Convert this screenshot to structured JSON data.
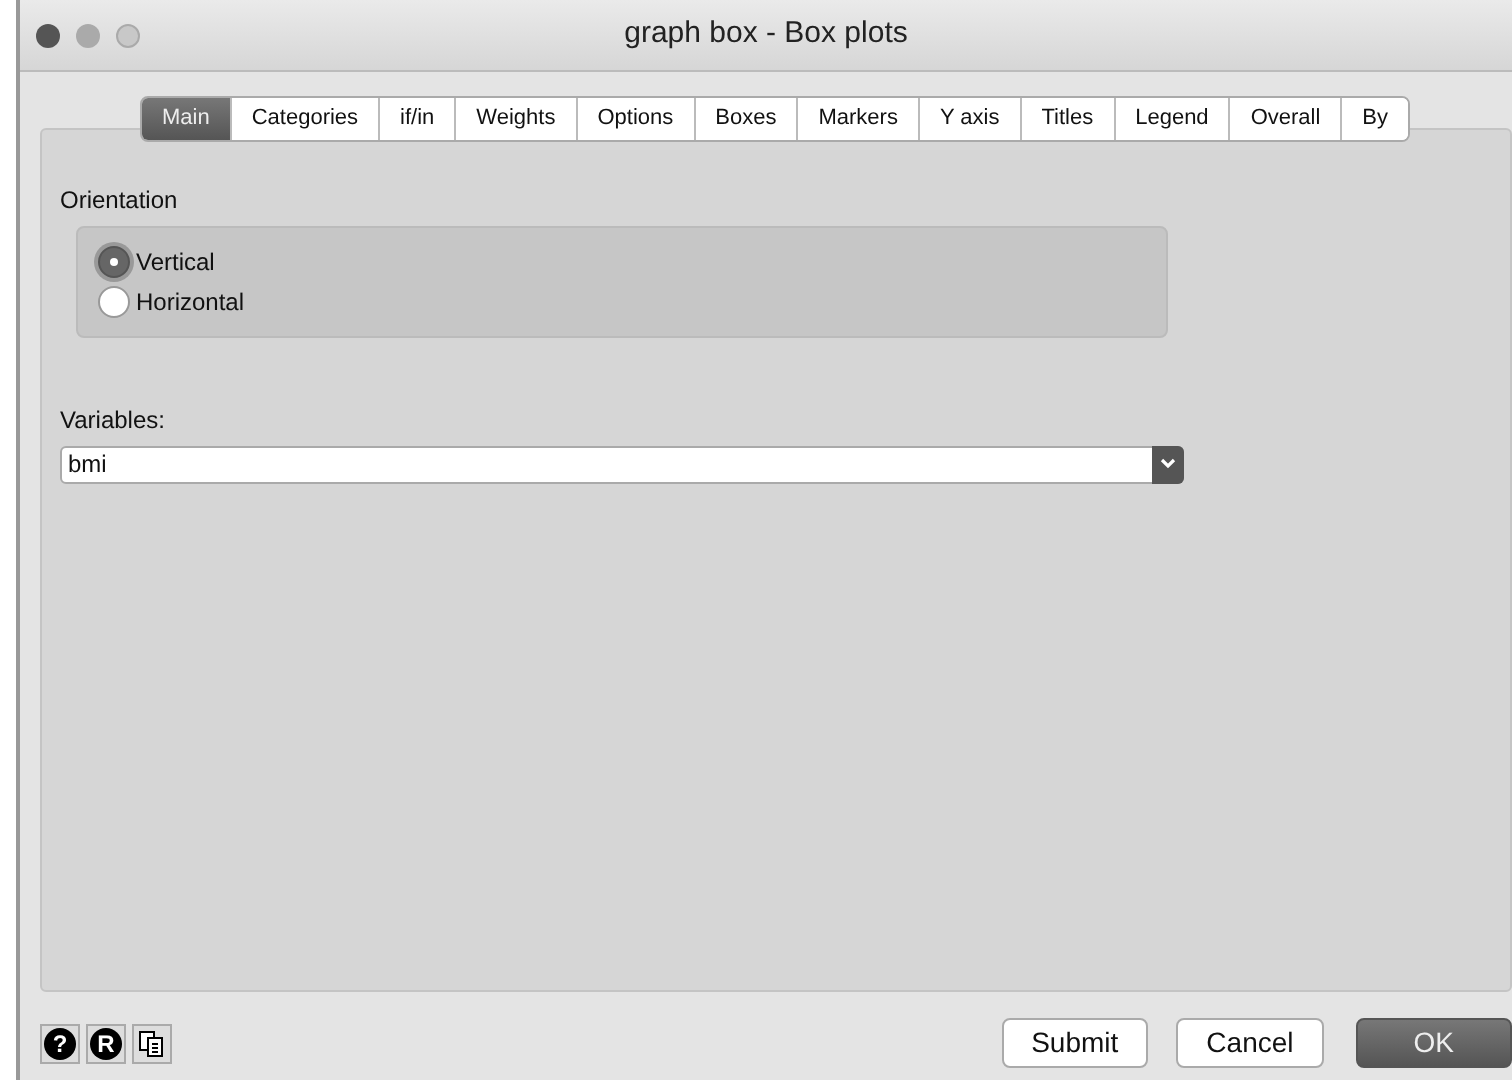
{
  "window": {
    "title": "graph box - Box plots"
  },
  "tabs": [
    {
      "label": "Main",
      "selected": true
    },
    {
      "label": "Categories",
      "selected": false
    },
    {
      "label": "if/in",
      "selected": false
    },
    {
      "label": "Weights",
      "selected": false
    },
    {
      "label": "Options",
      "selected": false
    },
    {
      "label": "Boxes",
      "selected": false
    },
    {
      "label": "Markers",
      "selected": false
    },
    {
      "label": "Y axis",
      "selected": false
    },
    {
      "label": "Titles",
      "selected": false
    },
    {
      "label": "Legend",
      "selected": false
    },
    {
      "label": "Overall",
      "selected": false
    },
    {
      "label": "By",
      "selected": false
    }
  ],
  "orientation": {
    "label": "Orientation",
    "options": [
      {
        "label": "Vertical",
        "selected": true
      },
      {
        "label": "Horizontal",
        "selected": false
      }
    ]
  },
  "variables": {
    "label": "Variables:",
    "value": "bmi"
  },
  "tool_buttons": [
    {
      "kind": "help",
      "text": "?"
    },
    {
      "kind": "r",
      "text": "R"
    },
    {
      "kind": "copy"
    }
  ],
  "buttons": [
    {
      "label": "Submit",
      "primary": false
    },
    {
      "label": "Cancel",
      "primary": false
    },
    {
      "label": "OK",
      "primary": true
    }
  ]
}
